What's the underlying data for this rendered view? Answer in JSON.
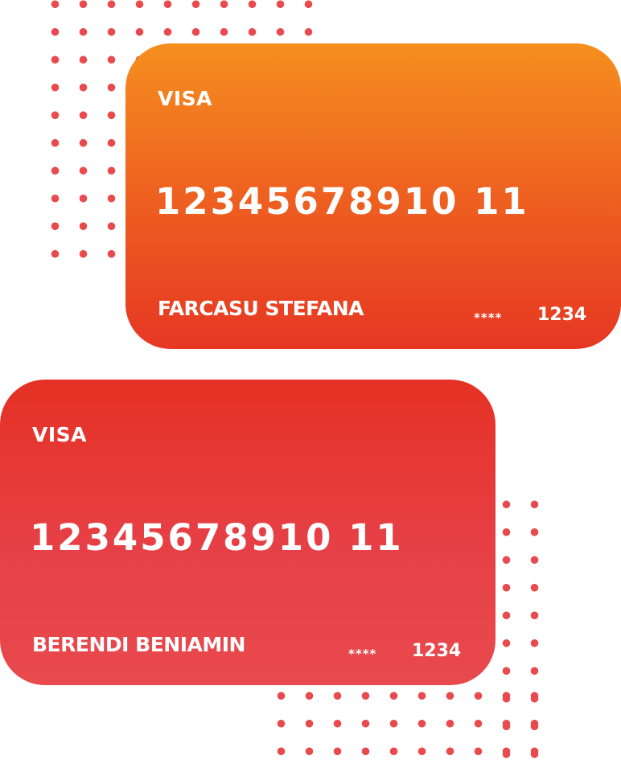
{
  "cards": [
    {
      "brand": "VISA",
      "number": "12345678910 11",
      "holder": "FARCASU STEFANA",
      "masked": "****",
      "last4": "1234"
    },
    {
      "brand": "VISA",
      "number": "12345678910 11",
      "holder": "BERENDI BENIAMIN",
      "masked": "****",
      "last4": "1234"
    }
  ],
  "colors": {
    "card1_top": "#f68f1f",
    "card1_bottom": "#e63723",
    "card2_top": "#e53124",
    "card2_bottom": "#e84a4e",
    "dots": "#e84a4e",
    "text": "#ffffff"
  }
}
